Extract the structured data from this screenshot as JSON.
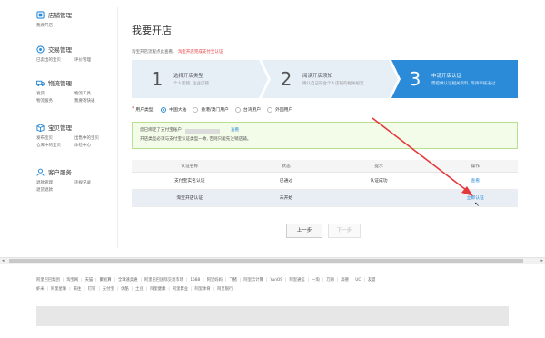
{
  "sidebar": {
    "sections": [
      {
        "title": "店铺管理",
        "icon": "shop-icon",
        "links": [
          "我要开店"
        ]
      },
      {
        "title": "交易管理",
        "icon": "trade-icon",
        "links": [
          "已卖出的宝贝",
          "评价管理"
        ]
      },
      {
        "title": "物流管理",
        "icon": "truck-icon",
        "links": [
          "发货",
          "物流工具",
          "物流服务",
          "我要寄快递"
        ]
      },
      {
        "title": "宝贝管理",
        "icon": "package-icon",
        "links": [
          "发布宝贝",
          "出售中的宝贝",
          "仓库中的宝贝",
          "体检中心"
        ]
      },
      {
        "title": "客户服务",
        "icon": "service-icon",
        "links": [
          "退款管理",
          "违规记录",
          "退货退款"
        ]
      }
    ]
  },
  "main": {
    "title": "我要开店",
    "notice_prefix": "淘宝开店流程点此查看。",
    "notice_red": "淘宝开店完成支付宝认证",
    "steps": [
      {
        "num": "1",
        "title": "选择开店类型",
        "sub": "个人店铺, 企业店铺"
      },
      {
        "num": "2",
        "title": "阅读开店须知",
        "sub": "确认自己符合个人店铺的相关规定"
      },
      {
        "num": "3",
        "title": "申请开店认证",
        "sub": "需提供认证相关资料, 等待审核通过"
      }
    ],
    "radio": {
      "label": "用户类型:",
      "options": [
        "中国大陆",
        "香港/澳门用户",
        "台湾用户",
        "外国用户"
      ],
      "selected": "中国大陆"
    },
    "info": {
      "line1_prefix": "您已绑定了支付宝账户",
      "line1_link": "查看",
      "line2": "开店类型必须与支付宝认证类型一致, 否则只能先注销店铺。"
    },
    "table": {
      "headers": [
        "认证名称",
        "状态",
        "提示",
        "操作"
      ],
      "rows": [
        {
          "name": "支付宝实名认证",
          "status": "已通过",
          "hint": "认证成功",
          "action": "查看"
        },
        {
          "name": "淘宝开店认证",
          "status": "未开始",
          "hint": "",
          "action": "立即认证"
        }
      ]
    },
    "buttons": {
      "prev": "上一步",
      "next": "下一步"
    }
  },
  "footer": {
    "row1": [
      "阿里巴巴集团",
      "淘宝网",
      "天猫",
      "聚划算",
      "全球速卖通",
      "阿里巴巴国际交易市场",
      "1688",
      "阿里妈妈",
      "飞猪",
      "阿里云计算",
      "YunOS",
      "阿里通信",
      "一淘",
      "万网",
      "高德",
      "UC",
      "友盟"
    ],
    "row2": [
      "虾米",
      "阿里星球",
      "来往",
      "钉钉",
      "支付宝",
      "优酷",
      "土豆",
      "阿里健康",
      "阿里影业",
      "阿里体育",
      "阿里银行"
    ]
  },
  "colors": {
    "step_active": "#2b8bd8",
    "step_inactive": "#e6eef6",
    "link": "#2b8bd8",
    "success": "#4caf32",
    "arrow": "#e4393c"
  }
}
